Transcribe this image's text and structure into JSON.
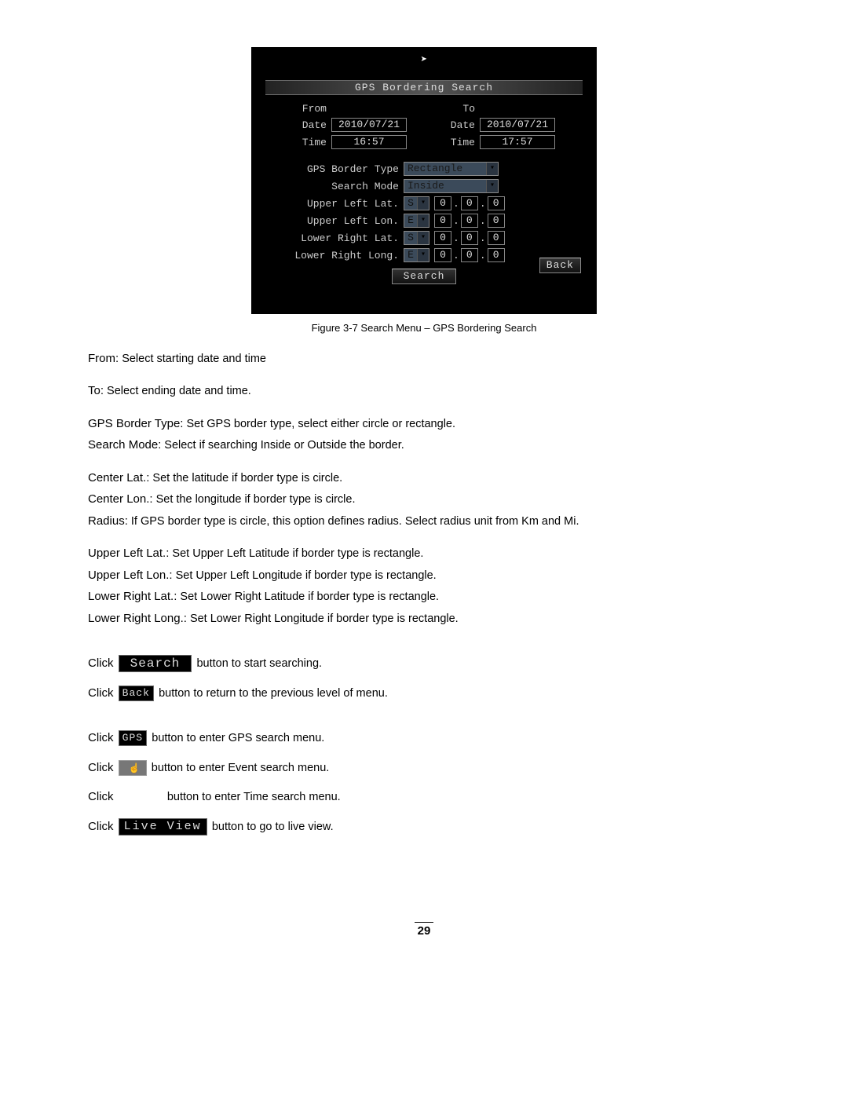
{
  "osd": {
    "title": "GPS Bordering Search",
    "from_label": "From",
    "to_label": "To",
    "date_label": "Date",
    "time_label": "Time",
    "from_date": "2010/07/21",
    "from_time": "16:57",
    "to_date": "2010/07/21",
    "to_time": "17:57",
    "border_type_label": "GPS Border Type",
    "border_type_value": "Rectangle",
    "search_mode_label": "Search Mode",
    "search_mode_value": "Inside",
    "rows": [
      {
        "label": "Upper Left Lat.",
        "hemi": "S",
        "a": "0",
        "b": "0",
        "c": "0"
      },
      {
        "label": "Upper Left Lon.",
        "hemi": "E",
        "a": "0",
        "b": "0",
        "c": "0"
      },
      {
        "label": "Lower Right Lat.",
        "hemi": "S",
        "a": "0",
        "b": "0",
        "c": "0"
      },
      {
        "label": "Lower Right Long.",
        "hemi": "E",
        "a": "0",
        "b": "0",
        "c": "0"
      }
    ],
    "search_btn": "Search",
    "back_btn": "Back"
  },
  "caption": "Figure 3-7 Search Menu – GPS Bordering Search",
  "desc": {
    "from_term": "From:",
    "from_txt": " Select starting date and time",
    "to_term": "To:",
    "to_txt": " Select ending date and time.",
    "gbt_term": "GPS Border Type:",
    "gbt_txt": " Set GPS border type, select either circle or rectangle.",
    "sm_term": "Search Mode",
    "sm_txt": ": Select if searching Inside or Outside the border.",
    "clat_term": "Center Lat.:",
    "clat_txt": " Set the latitude if border type is circle.",
    "clon_term": "Center Lon.:",
    "clon_txt": "  Set the longitude if border type is circle.",
    "rad_term": "Radius:",
    "rad_txt": " If GPS border type is circle, this option defines radius. Select radius unit from Km and Mi.",
    "ull_term": "Upper Left Lat.:",
    "ull_txt": " Set Upper Left Latitude if border type is rectangle.",
    "ulo_term": "Upper Left Lon.:",
    "ulo_txt": " Set Upper Left Longitude if border type is rectangle.",
    "lrl_term": "Lower Right Lat.:",
    "lrl_txt": " Set Lower Right Latitude if border type is rectangle.",
    "lrlo_term": "Lower Right Long.:",
    "lrlo_txt": " Set Lower Right Longitude if border type is rectangle."
  },
  "clicks": {
    "click": "Click ",
    "search_btn": "Search",
    "search_after": " button to start searching.",
    "back_btn": "Back",
    "back_after": " button to return to the previous level of menu.",
    "gps_btn": "GPS",
    "gps_after": " button to enter GPS search menu.",
    "event_btn": "",
    "event_after": " button to enter Event search menu.",
    "time_after": " button to enter Time search menu.",
    "live_btn": "Live View",
    "live_after": " button to go to live view."
  },
  "page_number": "29"
}
